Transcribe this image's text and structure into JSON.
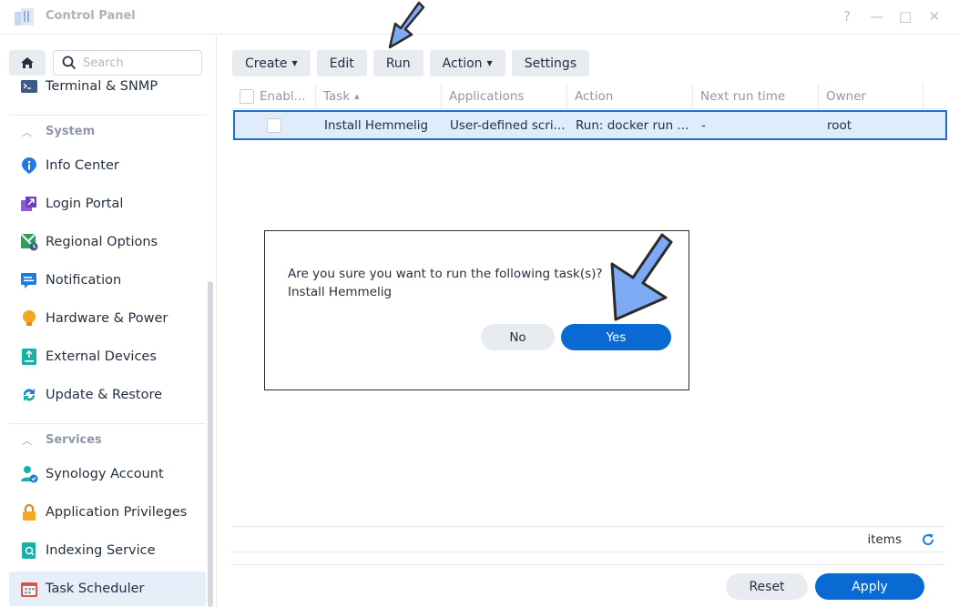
{
  "window": {
    "title": "Control Panel",
    "help_glyph": "?",
    "minimize_glyph": "—",
    "maximize_glyph": "□",
    "close_glyph": "✕"
  },
  "sidebar": {
    "search_placeholder": "Search",
    "top_item": "Terminal & SNMP",
    "sections": [
      {
        "title": "System",
        "items": [
          "Info Center",
          "Login Portal",
          "Regional Options",
          "Notification",
          "Hardware & Power",
          "External Devices",
          "Update & Restore"
        ]
      },
      {
        "title": "Services",
        "items": [
          "Synology Account",
          "Application Privileges",
          "Indexing Service",
          "Task Scheduler"
        ]
      }
    ],
    "active_item": "Task Scheduler"
  },
  "toolbar": {
    "create": "Create",
    "edit": "Edit",
    "run": "Run",
    "action": "Action",
    "settings": "Settings"
  },
  "grid": {
    "columns": [
      "Enabl...",
      "Task",
      "Applications",
      "Action",
      "Next run time",
      "Owner"
    ],
    "sort_glyph": "▲",
    "rows": [
      {
        "task": "Install Hemmelig",
        "applications": "User-defined scri...",
        "action": "Run: docker run ...",
        "next_run_time": "-",
        "owner": "root",
        "selected": true
      }
    ]
  },
  "footer": {
    "items_label": "items",
    "reset": "Reset",
    "apply": "Apply"
  },
  "dialog": {
    "line1": "Are you sure you want to run the following task(s)?",
    "line2": "Install Hemmelig",
    "no": "No",
    "yes": "Yes"
  },
  "colors": {
    "accent": "#0a6ad4",
    "selection_border": "#1f6ed4",
    "selection_fill": "#e0ecfb",
    "annotation_arrow": "#7eaaf5"
  }
}
